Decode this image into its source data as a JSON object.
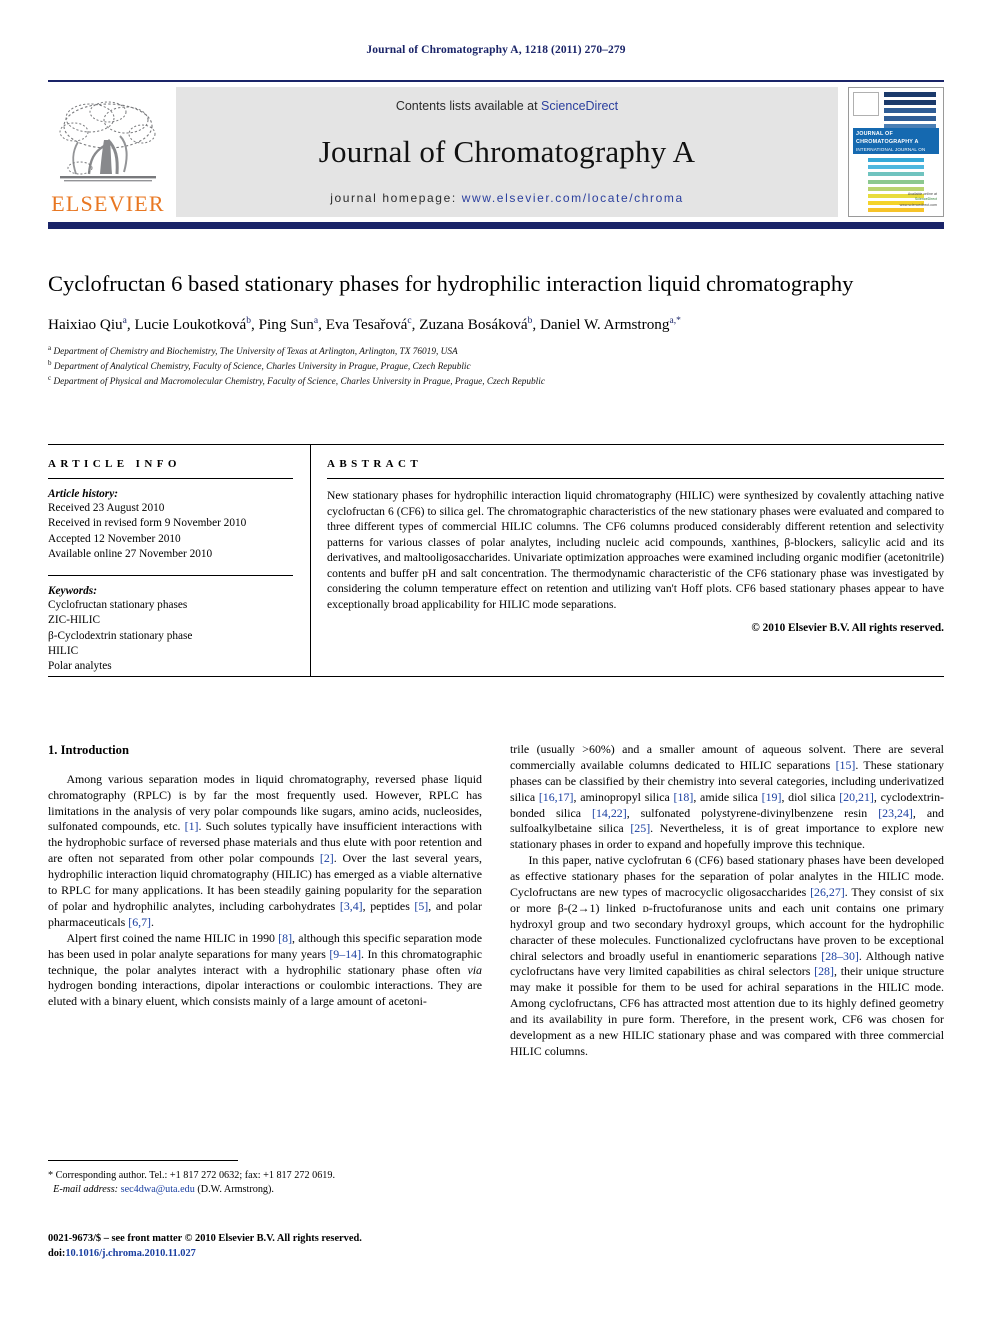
{
  "running_head": "Journal of Chromatography A, 1218 (2011) 270–279",
  "masthead": {
    "publisher_name": "ELSEVIER",
    "contents_prefix": "Contents lists available at",
    "contents_link": "ScienceDirect",
    "journal_title": "Journal of Chromatography A",
    "homepage_prefix": "journal homepage:",
    "homepage_url": "www.elsevier.com/locate/chroma",
    "cover": {
      "band_title": "JOURNAL OF CHROMATOGRAPHY A",
      "band_subtitle": "INTERNATIONAL JOURNAL ON CHROMATOGRAPHY, ELECTROPHORESIS AND RELATED TECHNIQUES",
      "sd_available": "Available online at",
      "sd_name": "ScienceDirect",
      "sd_sub": "www.sciencedirect.com"
    },
    "colors": {
      "rule": "#1a2468",
      "banner_bg": "#e4e4e4",
      "link": "#2b3f9e",
      "elsevier_orange": "#e87722",
      "cover_band": "#1569b0"
    }
  },
  "article": {
    "title": "Cyclofructan 6 based stationary phases for hydrophilic interaction liquid chromatography",
    "authors": [
      {
        "name": "Haixiao Qiu",
        "sup": "a"
      },
      {
        "name": "Lucie Loukotková",
        "sup": "b"
      },
      {
        "name": "Ping Sun",
        "sup": "a"
      },
      {
        "name": "Eva Tesařová",
        "sup": "c"
      },
      {
        "name": "Zuzana Bosáková",
        "sup": "b"
      },
      {
        "name": "Daniel W. Armstrong",
        "sup": "a,*"
      }
    ],
    "affiliations": [
      {
        "sup": "a",
        "text": "Department of Chemistry and Biochemistry, The University of Texas at Arlington, Arlington, TX 76019, USA"
      },
      {
        "sup": "b",
        "text": "Department of Analytical Chemistry, Faculty of Science, Charles University in Prague, Prague, Czech Republic"
      },
      {
        "sup": "c",
        "text": "Department of Physical and Macromolecular Chemistry, Faculty of Science, Charles University in Prague, Prague, Czech Republic"
      }
    ]
  },
  "article_info": {
    "heading": "ARTICLE INFO",
    "history_label": "Article history:",
    "history": [
      "Received 23 August 2010",
      "Received in revised form 9 November 2010",
      "Accepted 12 November 2010",
      "Available online 27 November 2010"
    ],
    "keywords_label": "Keywords:",
    "keywords": [
      "Cyclofructan stationary phases",
      "ZIC-HILIC",
      "β-Cyclodextrin stationary phase",
      "HILIC",
      "Polar analytes"
    ]
  },
  "abstract": {
    "heading": "ABSTRACT",
    "text": "New stationary phases for hydrophilic interaction liquid chromatography (HILIC) were synthesized by covalently attaching native cyclofructan 6 (CF6) to silica gel. The chromatographic characteristics of the new stationary phases were evaluated and compared to three different types of commercial HILIC columns. The CF6 columns produced considerably different retention and selectivity patterns for various classes of polar analytes, including nucleic acid compounds, xanthines, β-blockers, salicylic acid and its derivatives, and maltooligosaccharides. Univariate optimization approaches were examined including organic modifier (acetonitrile) contents and buffer pH and salt concentration. The thermodynamic characteristic of the CF6 stationary phase was investigated by considering the column temperature effect on retention and utilizing van't Hoff plots. CF6 based stationary phases appear to have exceptionally broad applicability for HILIC mode separations.",
    "copyright": "© 2010 Elsevier B.V. All rights reserved."
  },
  "introduction": {
    "section_number_title": "1. Introduction",
    "left_paragraphs": [
      "Among various separation modes in liquid chromatography, reversed phase liquid chromatography (RPLC) is by far the most frequently used. However, RPLC has limitations in the analysis of very polar compounds like sugars, amino acids, nucleosides, sulfonated compounds, etc. [1]. Such solutes typically have insufficient interactions with the hydrophobic surface of reversed phase materials and thus elute with poor retention and are often not separated from other polar compounds [2]. Over the last several years, hydrophilic interaction liquid chromatography (HILIC) has emerged as a viable alternative to RPLC for many applications. It has been steadily gaining popularity for the separation of polar and hydrophilic analytes, including carbohydrates [3,4], peptides [5], and polar pharmaceuticals [6,7].",
      "Alpert first coined the name HILIC in 1990 [8], although this specific separation mode has been used in polar analyte separations for many years [9–14]. In this chromatographic technique, the polar analytes interact with a hydrophilic stationary phase often via hydrogen bonding interactions, dipolar interactions or coulombic interactions. They are eluted with a binary eluent, which consists mainly of a large amount of acetoni-"
    ],
    "right_paragraphs": [
      "trile (usually >60%) and a smaller amount of aqueous solvent. There are several commercially available columns dedicated to HILIC separations [15]. These stationary phases can be classified by their chemistry into several categories, including underivatized silica [16,17], aminopropyl silica [18], amide silica [19], diol silica [20,21], cyclodextrin-bonded silica [14,22], sulfonated polystyrene-divinylbenzene resin [23,24], and sulfoalkylbetaine silica [25]. Nevertheless, it is of great importance to explore new stationary phases in order to expand and hopefully improve this technique.",
      "In this paper, native cyclofrutan 6 (CF6) based stationary phases have been developed as effective stationary phases for the separation of polar analytes in the HILIC mode. Cyclofructans are new types of macrocyclic oligosaccharides [26,27]. They consist of six or more β-(2→1) linked ᴅ-fructofuranose units and each unit contains one primary hydroxyl group and two secondary hydroxyl groups, which account for the hydrophilic character of these molecules. Functionalized cyclofructans have proven to be exceptional chiral selectors and broadly useful in enantiomeric separations [28–30]. Although native cyclofructans have very limited capabilities as chiral selectors [28], their unique structure may make it possible for them to be used for achiral separations in the HILIC mode. Among cyclofructans, CF6 has attracted most attention due to its highly defined geometry and its availability in pure form. Therefore, in the present work, CF6 was chosen for development as a new HILIC stationary phase and was compared with three commercial HILIC columns."
    ]
  },
  "footnotes": {
    "corresponding": "* Corresponding author. Tel.: +1 817 272 0632; fax: +1 817 272 0619.",
    "email_label": "E-mail address:",
    "email": "sec4dwa@uta.edu",
    "email_suffix": "(D.W. Armstrong).",
    "issn_line": "0021-9673/$ – see front matter © 2010 Elsevier B.V. All rights reserved.",
    "doi_label": "doi:",
    "doi": "10.1016/j.chroma.2010.11.027"
  }
}
